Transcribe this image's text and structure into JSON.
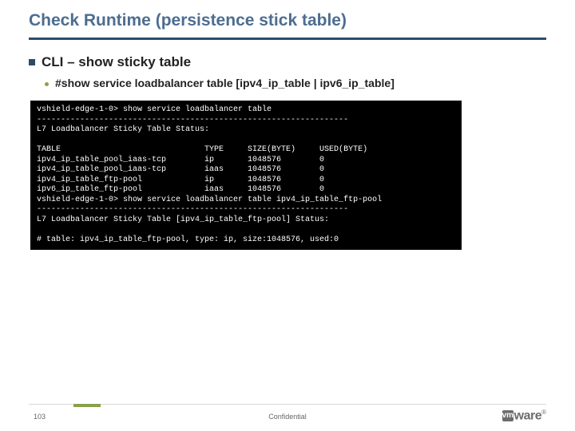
{
  "title": "Check Runtime (persistence stick table)",
  "bullets": {
    "l1": "CLI – show sticky table",
    "l2": "#show service loadbalancer table [ipv4_ip_table | ipv6_ip_table]"
  },
  "terminal": "vshield-edge-1-0> show service loadbalancer table\n-----------------------------------------------------------------\nL7 Loadbalancer Sticky Table Status:\n\nTABLE                              TYPE     SIZE(BYTE)     USED(BYTE)\nipv4_ip_table_pool_iaas-tcp        ip       1048576        0\nipv4_ip_table_pool_iaas-tcp        iaas     1048576        0\nipv4_ip_table_ftp-pool             ip       1048576        0\nipv6_ip_table_ftp-pool             iaas     1048576        0\nvshield-edge-1-0> show service loadbalancer table ipv4_ip_table_ftp-pool\n-----------------------------------------------------------------\nL7 Loadbalancer Sticky Table [ipv4_ip_table_ftp-pool] Status:\n\n# table: ipv4_ip_table_ftp-pool, type: ip, size:1048576, used:0",
  "footer": {
    "page": "103",
    "confidential": "Confidential",
    "logo": {
      "vm": "vm",
      "ware": "ware",
      "reg": "®"
    }
  }
}
